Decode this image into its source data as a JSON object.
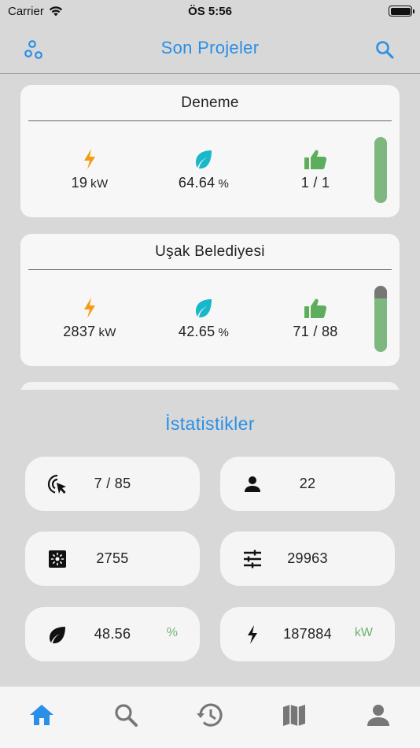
{
  "status": {
    "carrier": "Carrier",
    "time": "ÖS 5:56"
  },
  "nav": {
    "title": "Son Projeler",
    "left_icon": "settings-circles-icon",
    "right_icon": "search-icon"
  },
  "projects": [
    {
      "name": "Deneme",
      "power": "19",
      "power_unit": "kW",
      "green": "64.64",
      "green_unit": "%",
      "likes": "1 / 1",
      "level": 1.0
    },
    {
      "name": "Uşak Belediyesi",
      "power": "2837",
      "power_unit": "kW",
      "green": "42.65",
      "green_unit": "%",
      "likes": "71 / 88",
      "level": 0.81
    }
  ],
  "stats": {
    "title": "İstatistikler",
    "items": [
      {
        "icon": "cursor-click-icon",
        "value": "7 / 85",
        "unit": ""
      },
      {
        "icon": "user-icon",
        "value": "22",
        "unit": ""
      },
      {
        "icon": "solar-panel-icon",
        "value": "2755",
        "unit": ""
      },
      {
        "icon": "sliders-icon",
        "value": "29963",
        "unit": ""
      },
      {
        "icon": "leaf-icon",
        "value": "48.56",
        "unit": "%"
      },
      {
        "icon": "bolt-icon",
        "value": "187884",
        "unit": "kW"
      }
    ]
  },
  "tabs": [
    {
      "icon": "home-icon",
      "active": true
    },
    {
      "icon": "search-icon",
      "active": false
    },
    {
      "icon": "history-icon",
      "active": false
    },
    {
      "icon": "map-icon",
      "active": false
    },
    {
      "icon": "profile-icon",
      "active": false
    }
  ],
  "colors": {
    "accent": "#2a8fe6",
    "bolt": "#f39c12",
    "leaf": "#17b8c9",
    "like": "#5cae5c",
    "level": "#7db87f",
    "tab_inactive": "#777777"
  }
}
